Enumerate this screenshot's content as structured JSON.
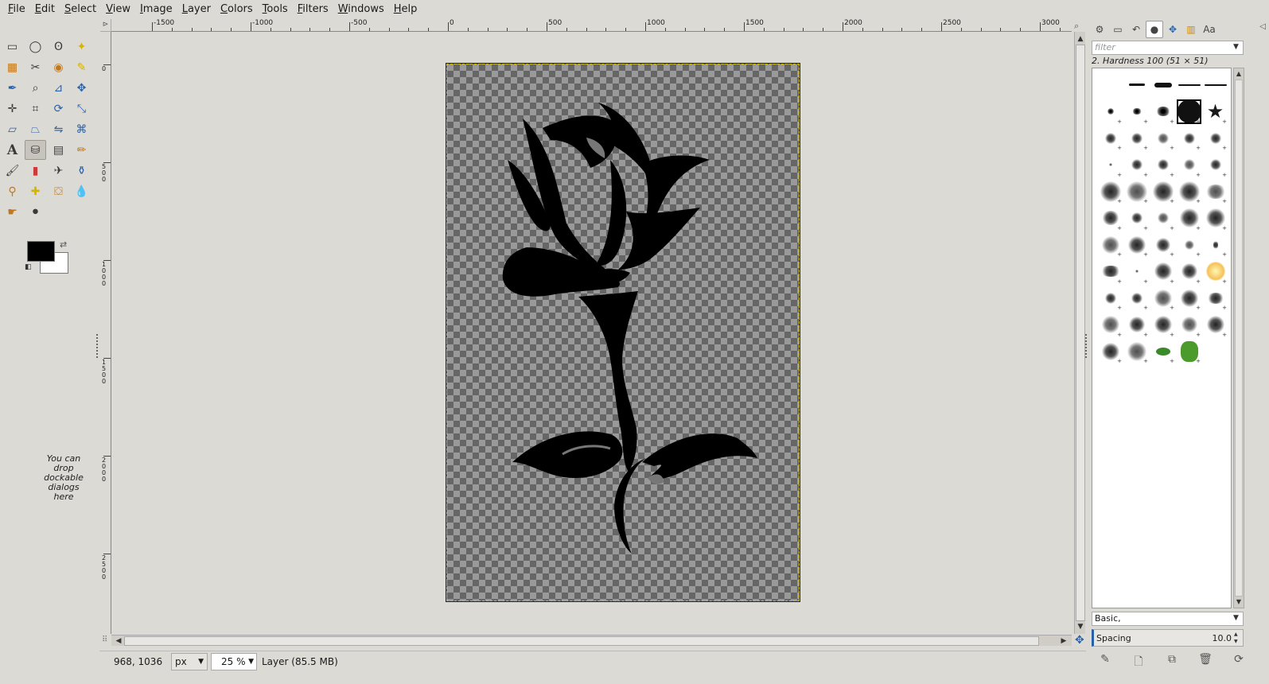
{
  "menubar": [
    {
      "mnemonic": "F",
      "rest": "ile"
    },
    {
      "mnemonic": "E",
      "rest": "dit"
    },
    {
      "mnemonic": "S",
      "rest": "elect"
    },
    {
      "mnemonic": "V",
      "rest": "iew"
    },
    {
      "mnemonic": "I",
      "rest": "mage"
    },
    {
      "mnemonic": "L",
      "rest": "ayer"
    },
    {
      "mnemonic": "C",
      "rest": "olors"
    },
    {
      "mnemonic": "T",
      "rest": "ools"
    },
    {
      "mnemonic": "F",
      "rest": "ilters"
    },
    {
      "mnemonic": "W",
      "rest": "indows"
    },
    {
      "mnemonic": "H",
      "rest": "elp"
    }
  ],
  "toolbox": {
    "tools": [
      {
        "name": "rect-select-icon",
        "glyph": "▭",
        "color": ""
      },
      {
        "name": "ellipse-select-icon",
        "glyph": "◯",
        "color": ""
      },
      {
        "name": "free-select-icon",
        "glyph": "ʘ",
        "color": ""
      },
      {
        "name": "fuzzy-select-icon",
        "glyph": "✦",
        "color": "yellow"
      },
      {
        "name": "color-select-icon",
        "glyph": "▦",
        "color": "orange"
      },
      {
        "name": "scissors-icon",
        "glyph": "✂",
        "color": ""
      },
      {
        "name": "foreground-select-icon",
        "glyph": "◉",
        "color": "orange"
      },
      {
        "name": "paths-icon",
        "glyph": "✎",
        "color": "yellow"
      },
      {
        "name": "color-picker-icon",
        "glyph": "✒",
        "color": "blue"
      },
      {
        "name": "zoom-icon",
        "glyph": "⌕",
        "color": ""
      },
      {
        "name": "measure-icon",
        "glyph": "⊿",
        "color": "blue"
      },
      {
        "name": "move-icon",
        "glyph": "✥",
        "color": "blue"
      },
      {
        "name": "align-icon",
        "glyph": "✛",
        "color": ""
      },
      {
        "name": "crop-icon",
        "glyph": "⌗",
        "color": ""
      },
      {
        "name": "rotate-icon",
        "glyph": "⟳",
        "color": "blue"
      },
      {
        "name": "scale-icon",
        "glyph": "⤡",
        "color": "blue"
      },
      {
        "name": "shear-icon",
        "glyph": "▱",
        "color": "blue"
      },
      {
        "name": "perspective-icon",
        "glyph": "⏢",
        "color": "blue"
      },
      {
        "name": "flip-icon",
        "glyph": "⇋",
        "color": "blue"
      },
      {
        "name": "cage-icon",
        "glyph": "⌘",
        "color": "blue"
      },
      {
        "name": "text-icon",
        "glyph": "A",
        "color": "big"
      },
      {
        "name": "bucket-fill-icon",
        "glyph": "⛁",
        "color": "",
        "active": true
      },
      {
        "name": "gradient-icon",
        "glyph": "▤",
        "color": ""
      },
      {
        "name": "pencil-icon",
        "glyph": "✏",
        "color": "orange"
      },
      {
        "name": "paintbrush-icon",
        "glyph": "🖌",
        "color": ""
      },
      {
        "name": "eraser-icon",
        "glyph": "▮",
        "color": "red"
      },
      {
        "name": "airbrush-icon",
        "glyph": "✈",
        "color": ""
      },
      {
        "name": "ink-icon",
        "glyph": "⚱",
        "color": "blue"
      },
      {
        "name": "clone-icon",
        "glyph": "⚲",
        "color": "orange"
      },
      {
        "name": "heal-icon",
        "glyph": "✚",
        "color": "yellow"
      },
      {
        "name": "perspective-clone-icon",
        "glyph": "⛋",
        "color": "orange"
      },
      {
        "name": "blur-icon",
        "glyph": "💧",
        "color": "blue"
      },
      {
        "name": "smudge-icon",
        "glyph": "☛",
        "color": "orange"
      },
      {
        "name": "dodge-burn-icon",
        "glyph": "⚫",
        "color": ""
      }
    ],
    "drop_hint": "You can drop dockable dialogs here",
    "fg_color": "#000000",
    "bg_color": "#ffffff"
  },
  "canvas": {
    "ruler_h_labels": [
      "-1500",
      "-1000",
      "-500",
      "0",
      "500",
      "1000",
      "1500",
      "2000",
      "2500",
      "3000"
    ],
    "ruler_v_labels": [
      "0",
      "500",
      "1000",
      "1500",
      "2000",
      "2500"
    ]
  },
  "statusbar": {
    "coords": "968, 1036",
    "unit": "px",
    "zoom": "25 %",
    "message": "Layer (85.5 MB)"
  },
  "dock": {
    "tabs": [
      "tool-options-icon",
      "device-status-icon",
      "undo-history-icon",
      "brushes-icon",
      "patterns-icon",
      "gradients-icon",
      "fonts-icon"
    ],
    "filter_placeholder": "filter",
    "brush_name": "2. Hardness 100 (51 × 51)",
    "tag_value": "Basic,",
    "spacing_label": "Spacing",
    "spacing_value": "10.0"
  }
}
